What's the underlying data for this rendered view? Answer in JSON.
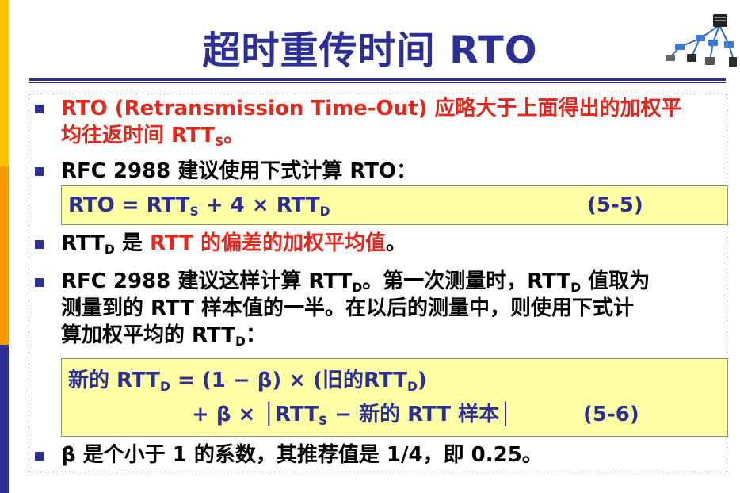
{
  "title": "超时重传时间 RTO",
  "bullet1": {
    "line1": "RTO (Retransmission Time-Out) 应略大于上面得出的加权平",
    "line2_main": "均往返时间 RTT",
    "line2_sub": "S",
    "line2_end": "。"
  },
  "bullet2": {
    "text": "RFC 2988 建议使用下式计算 RTO："
  },
  "formula1": {
    "lhs": "RTO",
    "eq": "=",
    "t1": "RTT",
    "t1_sub": "S",
    "plus": "+ 4",
    "times": "×",
    "t2": "RTT",
    "t2_sub": "D",
    "number": "(5-5)"
  },
  "bullet3": {
    "main": "RTT",
    "sub": "D",
    "mid": " 是 ",
    "red": "RTT 的偏差的加权平均值",
    "end": "。"
  },
  "bullet4": {
    "line1_a": "RFC 2988 建议这样计算 RTT",
    "line1_sub1": "D",
    "line1_b": "。第一次测量时，RTT",
    "line1_sub2": "D",
    "line1_c": " 值取为",
    "line2": "测量到的 RTT 样本值的一半。在以后的测量中，则使用下式计",
    "line3_a": "算加权平均的 RTT",
    "line3_sub": "D",
    "line3_b": "："
  },
  "formula2": {
    "line1_a": "新的 RTT",
    "line1_sub": "D",
    "line1_b": " = (1",
    "minus": "−",
    "beta1": "β)",
    "times1": "×",
    "line1_c": "(旧的RTT",
    "line1_sub2": "D",
    "line1_d": ")",
    "line2_a": "+ β",
    "times2": "×",
    "bar_l": "│",
    "t": "RTT",
    "t_sub": "S",
    "minus2": "−",
    "line2_b": "新的 RTT 样本",
    "bar_r": "│",
    "number": "(5-6)"
  },
  "bullet5": {
    "text": "β 是个小于 1 的系数，其推荐值是 1/4，即 0.25。"
  },
  "colors": {
    "title_blue": "#2b2f96",
    "highlight_red": "#e8251b",
    "formula_bg": "#ffffa6",
    "accent_yellow": "#f9c400",
    "accent_orange": "#f59a00",
    "accent_navy": "#2b2f96"
  },
  "icons": {
    "corner": "network-diagram-icon"
  }
}
